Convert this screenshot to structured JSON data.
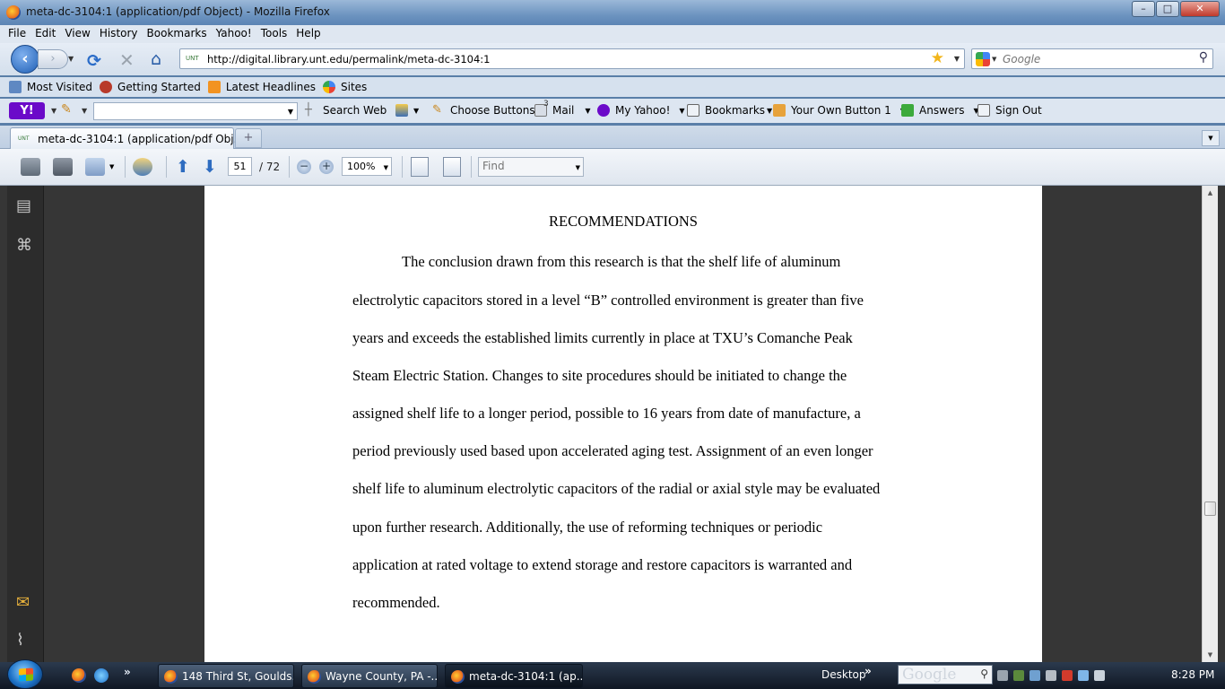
{
  "window": {
    "title": "meta-dc-3104:1 (application/pdf Object) - Mozilla Firefox",
    "controls": {
      "minimize": "–",
      "maximize": "□",
      "close": "✕"
    }
  },
  "menubar": {
    "items": [
      "File",
      "Edit",
      "View",
      "History",
      "Bookmarks",
      "Yahoo!",
      "Tools",
      "Help"
    ]
  },
  "navbar": {
    "url": "http://digital.library.unt.edu/permalink/meta-dc-3104:1",
    "site_icon_label": "UNT",
    "search_placeholder": "Google"
  },
  "bookmarks": {
    "items": [
      {
        "label": "Most Visited",
        "icon": "bookmarks-folder-icon"
      },
      {
        "label": "Getting Started",
        "icon": "firefox-icon"
      },
      {
        "label": "Latest Headlines",
        "icon": "rss-icon"
      },
      {
        "label": "Sites",
        "icon": "sites-icon"
      }
    ]
  },
  "yahoo_toolbar": {
    "logo": "Y!",
    "items": [
      {
        "label": "Search Web",
        "icon": "search-web-icon"
      },
      {
        "label": "Choose Buttons",
        "icon": "pencil-icon"
      },
      {
        "label": "Mail",
        "icon": "mail-icon",
        "badge": "3"
      },
      {
        "label": "My Yahoo!",
        "icon": "my-yahoo-icon"
      },
      {
        "label": "Bookmarks",
        "icon": "bookmarks-icon"
      },
      {
        "label": "Your Own Button 1",
        "icon": "custom-button-icon"
      },
      {
        "label": "Answers",
        "icon": "answers-icon"
      },
      {
        "label": "Sign Out",
        "icon": "sign-out-icon"
      }
    ]
  },
  "tabs": {
    "active": {
      "label": "meta-dc-3104:1 (application/pdf Obj...",
      "icon_label": "UNT"
    },
    "new_tab": "+"
  },
  "pdf_toolbar": {
    "current_page": "51",
    "total_pages": "/ 72",
    "zoom": "100%",
    "find_placeholder": "Find"
  },
  "document": {
    "heading": "RECOMMENDATIONS",
    "lines": [
      "The conclusion drawn from this research is that the shelf life of aluminum",
      "electrolytic capacitors stored in a level “B” controlled environment is greater than five",
      "years and exceeds the established limits currently in place at TXU’s Comanche Peak",
      "Steam Electric Station. Changes to site procedures should be initiated to change the",
      "assigned shelf life to a longer period, possible to 16 years from date of manufacture, a",
      "period previously used based upon accelerated aging test. Assignment of an even longer",
      "shelf life to aluminum electrolytic capacitors of the radial or axial style may be evaluated",
      "upon further research. Additionally, the use of reforming techniques or periodic",
      "application at rated voltage to extend storage and restore capacitors is warranted and",
      "recommended."
    ]
  },
  "taskbar": {
    "tasks": [
      {
        "label": "148 Third St, Goulds..."
      },
      {
        "label": "Wayne County, PA -..."
      },
      {
        "label": "meta-dc-3104:1 (ap..."
      }
    ],
    "desktop_label": "Desktop",
    "search_watermark": "Google",
    "clock": "8:28 PM"
  }
}
